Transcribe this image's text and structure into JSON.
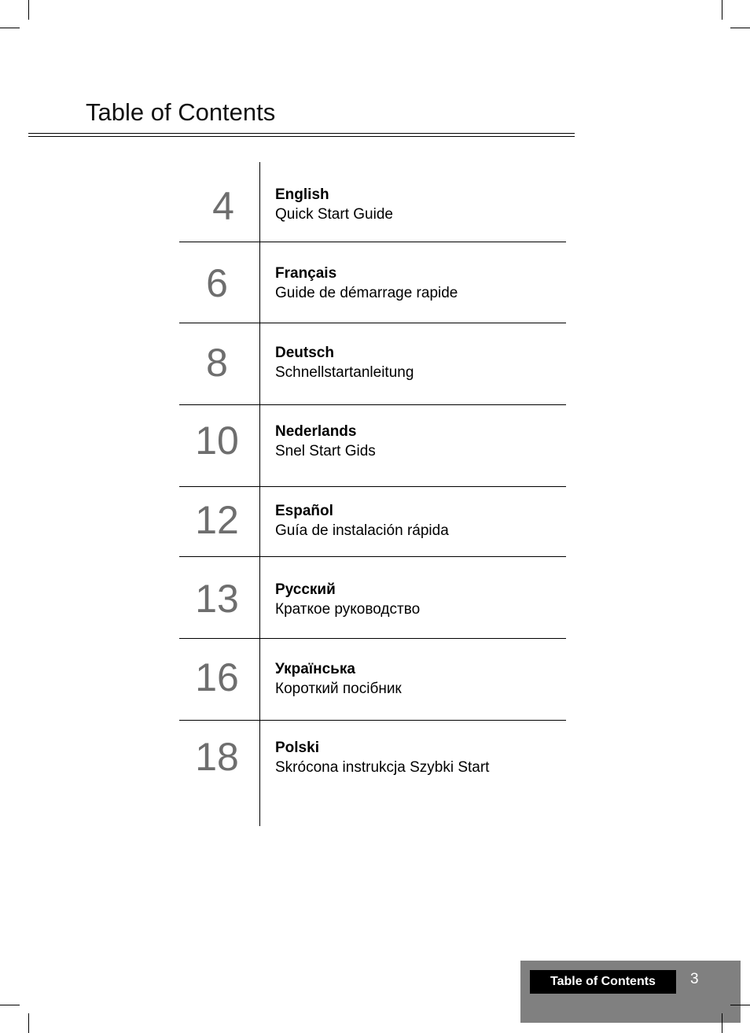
{
  "header": {
    "title": "Table of Contents"
  },
  "toc": {
    "entries": [
      {
        "page": "4",
        "language": "English",
        "title": "Quick Start Guide"
      },
      {
        "page": "6",
        "language": "Français",
        "title": "Guide de démarrage rapide"
      },
      {
        "page": "8",
        "language": "Deutsch",
        "title": "Schnellstartanleitung"
      },
      {
        "page": "10",
        "language": "Nederlands",
        "title": "Snel Start Gids"
      },
      {
        "page": "12",
        "language": "Español",
        "title": "Guía de instalación rápida"
      },
      {
        "page": "13",
        "language": "Русский",
        "title": "Краткое руководство"
      },
      {
        "page": "16",
        "language": "Українська",
        "title": "Короткий посібник"
      },
      {
        "page": "18",
        "language": "Polski",
        "title": "Skrócona instrukcja Szybki Start"
      }
    ]
  },
  "footer": {
    "section_label": "Table of Contents",
    "page_number": "3"
  },
  "colors": {
    "page_number_gray": "#6e6e6e",
    "footer_background": "#808080",
    "footer_label_background": "#000000",
    "footer_text": "#ffffff"
  }
}
